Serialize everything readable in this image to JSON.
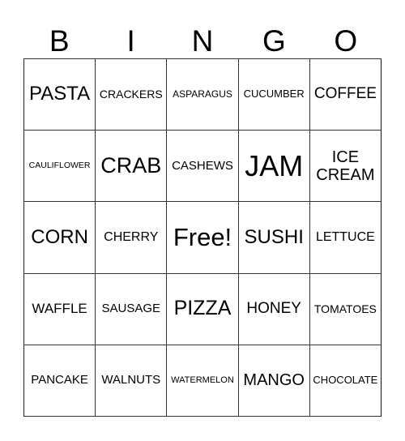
{
  "header": {
    "letters": [
      "B",
      "I",
      "N",
      "G",
      "O"
    ]
  },
  "card": {
    "rows": [
      [
        "PASTA",
        "CRACKERS",
        "ASPARAGUS",
        "CUCUMBER",
        "COFFEE"
      ],
      [
        "CAULIFLOWER",
        "CRAB",
        "CASHEWS",
        "JAM",
        "ICE CREAM"
      ],
      [
        "CORN",
        "CHERRY",
        "Free!",
        "SUSHI",
        "LETTUCE"
      ],
      [
        "WAFFLE",
        "SAUSAGE",
        "PIZZA",
        "HONEY",
        "TOMATOES"
      ],
      [
        "PANCAKE",
        "WALNUTS",
        "WATERMELON",
        "MANGO",
        "CHOCOLATE"
      ]
    ],
    "free_space_label": "Free!"
  }
}
